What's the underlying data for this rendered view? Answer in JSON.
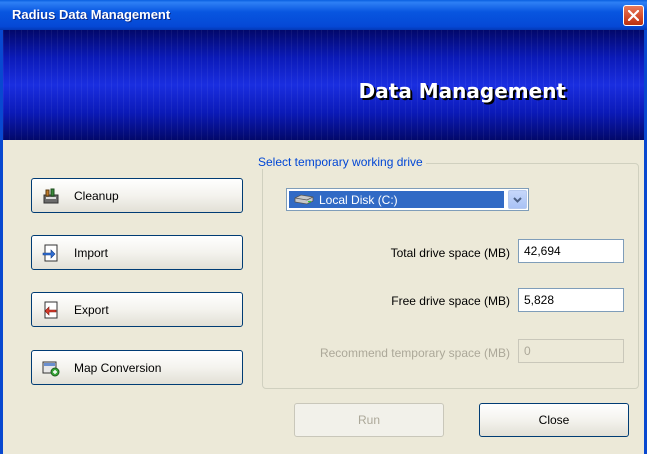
{
  "window": {
    "title": "Radius Data Management"
  },
  "banner": {
    "title": "Data Management"
  },
  "side_buttons": [
    {
      "label": "Cleanup",
      "icon": "cleanup-icon"
    },
    {
      "label": "Import",
      "icon": "import-icon"
    },
    {
      "label": "Export",
      "icon": "export-icon"
    },
    {
      "label": "Map Conversion",
      "icon": "map-conversion-icon"
    }
  ],
  "drive_group": {
    "legend": "Select temporary working drive",
    "selected_drive": "Local Disk (C:)",
    "total_label": "Total drive space (MB)",
    "total_value": "42,694",
    "free_label": "Free drive space (MB)",
    "free_value": "5,828",
    "recommend_label": "Recommend temporary space (MB)",
    "recommend_value": "0"
  },
  "actions": {
    "run_label": "Run",
    "close_label": "Close"
  },
  "colors": {
    "titlebar": "#0856e0",
    "banner": "#0b1ab8",
    "selection": "#316ac5",
    "legend": "#0046d5"
  }
}
